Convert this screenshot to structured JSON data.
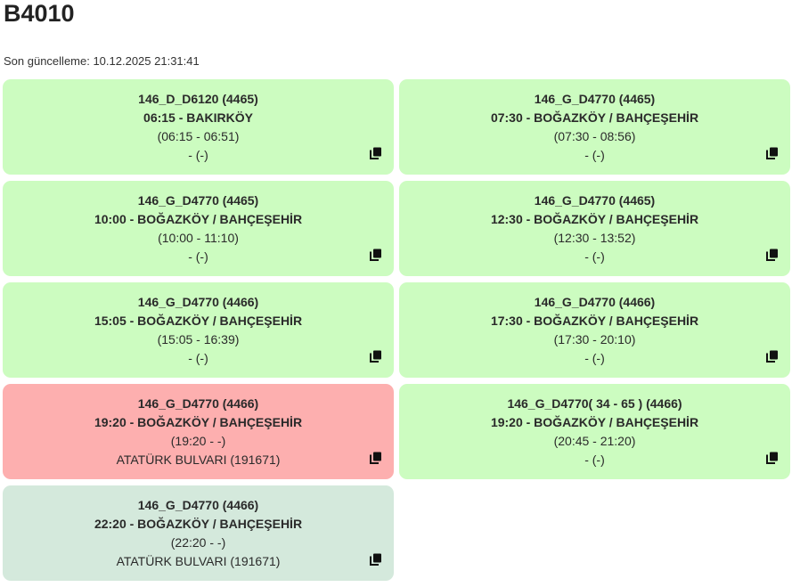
{
  "header": {
    "title": "B4010",
    "updated_label": "Son güncelleme: 10.12.2025 21:31:41"
  },
  "icons": {
    "copy": "copy-icon"
  },
  "colors": {
    "ok": "#ccfcc0",
    "late": "#fdafaf",
    "past": "#d4e9dc"
  },
  "cards": [
    {
      "status": "ok",
      "route": "146_D_D6120 (4465)",
      "trip": "06:15 - BAKIRKÖY",
      "times": "(06:15 - 06:51)",
      "stop": "- (-)"
    },
    {
      "status": "ok",
      "route": "146_G_D4770 (4465)",
      "trip": "07:30 - BOĞAZKÖY / BAHÇEŞEHİR",
      "times": "(07:30 - 08:56)",
      "stop": "- (-)"
    },
    {
      "status": "ok",
      "route": "146_G_D4770 (4465)",
      "trip": "10:00 - BOĞAZKÖY / BAHÇEŞEHİR",
      "times": "(10:00 - 11:10)",
      "stop": "- (-)"
    },
    {
      "status": "ok",
      "route": "146_G_D4770 (4465)",
      "trip": "12:30 - BOĞAZKÖY / BAHÇEŞEHİR",
      "times": "(12:30 - 13:52)",
      "stop": "- (-)"
    },
    {
      "status": "ok",
      "route": "146_G_D4770 (4466)",
      "trip": "15:05 - BOĞAZKÖY / BAHÇEŞEHİR",
      "times": "(15:05 - 16:39)",
      "stop": "- (-)"
    },
    {
      "status": "ok",
      "route": "146_G_D4770 (4466)",
      "trip": "17:30 - BOĞAZKÖY / BAHÇEŞEHİR",
      "times": "(17:30 - 20:10)",
      "stop": "- (-)"
    },
    {
      "status": "late",
      "route": "146_G_D4770 (4466)",
      "trip": "19:20 - BOĞAZKÖY / BAHÇEŞEHİR",
      "times": "(19:20 - -)",
      "stop": "ATATÜRK BULVARI (191671)"
    },
    {
      "status": "ok",
      "route": "146_G_D4770( 34 - 65 ) (4466)",
      "trip": "19:20 - BOĞAZKÖY / BAHÇEŞEHİR",
      "times": "(20:45 - 21:20)",
      "stop": "- (-)"
    },
    {
      "status": "past",
      "route": "146_G_D4770 (4466)",
      "trip": "22:20 - BOĞAZKÖY / BAHÇEŞEHİR",
      "times": "(22:20 - -)",
      "stop": "ATATÜRK BULVARI (191671)"
    }
  ]
}
